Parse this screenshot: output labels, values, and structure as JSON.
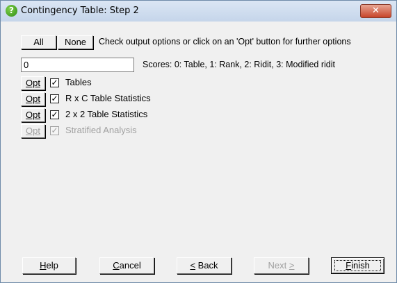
{
  "window": {
    "title": "Contingency Table: Step 2",
    "close_glyph": "✕"
  },
  "toolbar": {
    "all_label": "All",
    "none_label": "None",
    "hint": "Check output options or click on an 'Opt' button for further options"
  },
  "scores": {
    "value": "0",
    "label": "Scores: 0: Table, 1: Rank, 2: Ridit, 3: Modified ridit"
  },
  "options": [
    {
      "opt_label": "Opt",
      "label": "Tables",
      "checked": true,
      "enabled": true
    },
    {
      "opt_label": "Opt",
      "label": "R x C Table Statistics",
      "checked": true,
      "enabled": true
    },
    {
      "opt_label": "Opt",
      "label": "2 x 2 Table Statistics",
      "checked": true,
      "enabled": true
    },
    {
      "opt_label": "Opt",
      "label": "Stratified Analysis",
      "checked": true,
      "enabled": false
    }
  ],
  "check_glyph": "✓",
  "buttons": {
    "help": {
      "mnemonic": "H",
      "rest": "elp"
    },
    "cancel": {
      "mnemonic": "C",
      "rest": "ancel"
    },
    "back": {
      "prefix": "",
      "mnemonic": "<",
      "rest": " Back"
    },
    "next": {
      "label": "Next",
      "mnemonic": ">"
    },
    "finish": {
      "mnemonic": "F",
      "rest": "inish"
    }
  }
}
